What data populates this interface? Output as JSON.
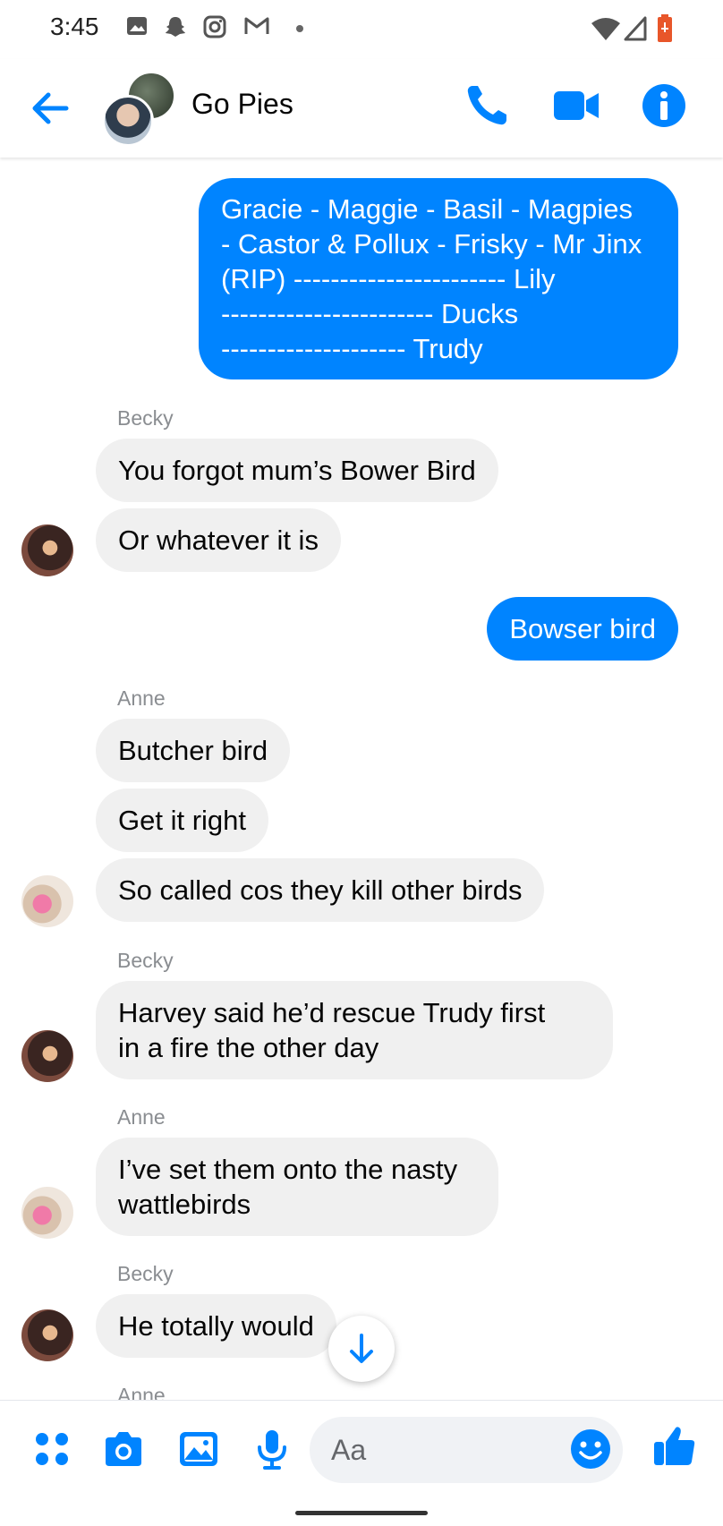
{
  "status_bar": {
    "time": "3:45",
    "icons": [
      "image-icon",
      "snapchat-icon",
      "instagram-icon",
      "gmail-icon",
      "dot-icon",
      "wifi-icon",
      "signal-icon",
      "battery-icon"
    ]
  },
  "header": {
    "title": "Go Pies",
    "actions": [
      "phone-icon",
      "video-icon",
      "info-icon"
    ]
  },
  "colors": {
    "accent": "#0084ff",
    "incoming_bubble": "#f0f0f0",
    "sender_text": "#8a8d91"
  },
  "messages": [
    {
      "from": "me",
      "lines": [
        "Gracie - Maggie - Basil - Magpies",
        "- Castor & Pollux - Frisky - Mr Jinx",
        "(RIP) ----------------------- Lily",
        "----------------------- Ducks",
        "-------------------- Trudy"
      ]
    },
    {
      "sender_label": "Becky"
    },
    {
      "from": "Becky",
      "text": "You forgot mum’s Bower Bird"
    },
    {
      "from": "Becky",
      "text": "Or whatever it is"
    },
    {
      "from": "me",
      "text": "Bowser bird"
    },
    {
      "sender_label": "Anne"
    },
    {
      "from": "Anne",
      "text": "Butcher bird"
    },
    {
      "from": "Anne",
      "text": "Get it right"
    },
    {
      "from": "Anne",
      "text": "So called cos they kill other birds"
    },
    {
      "sender_label": "Becky"
    },
    {
      "from": "Becky",
      "lines": [
        "Harvey said he’d rescue Trudy first",
        "in a fire the other day"
      ]
    },
    {
      "sender_label": "Anne"
    },
    {
      "from": "Anne",
      "lines": [
        "I’ve set them onto the nasty",
        "wattlebirds"
      ]
    },
    {
      "sender_label": "Becky"
    },
    {
      "from": "Becky",
      "text": "He totally would"
    },
    {
      "sender_label": "Anne"
    }
  ],
  "composer": {
    "placeholder": "Aa",
    "icons": [
      "apps-icon",
      "camera-icon",
      "gallery-icon",
      "microphone-icon",
      "emoji-icon",
      "thumbs-up-icon"
    ]
  }
}
